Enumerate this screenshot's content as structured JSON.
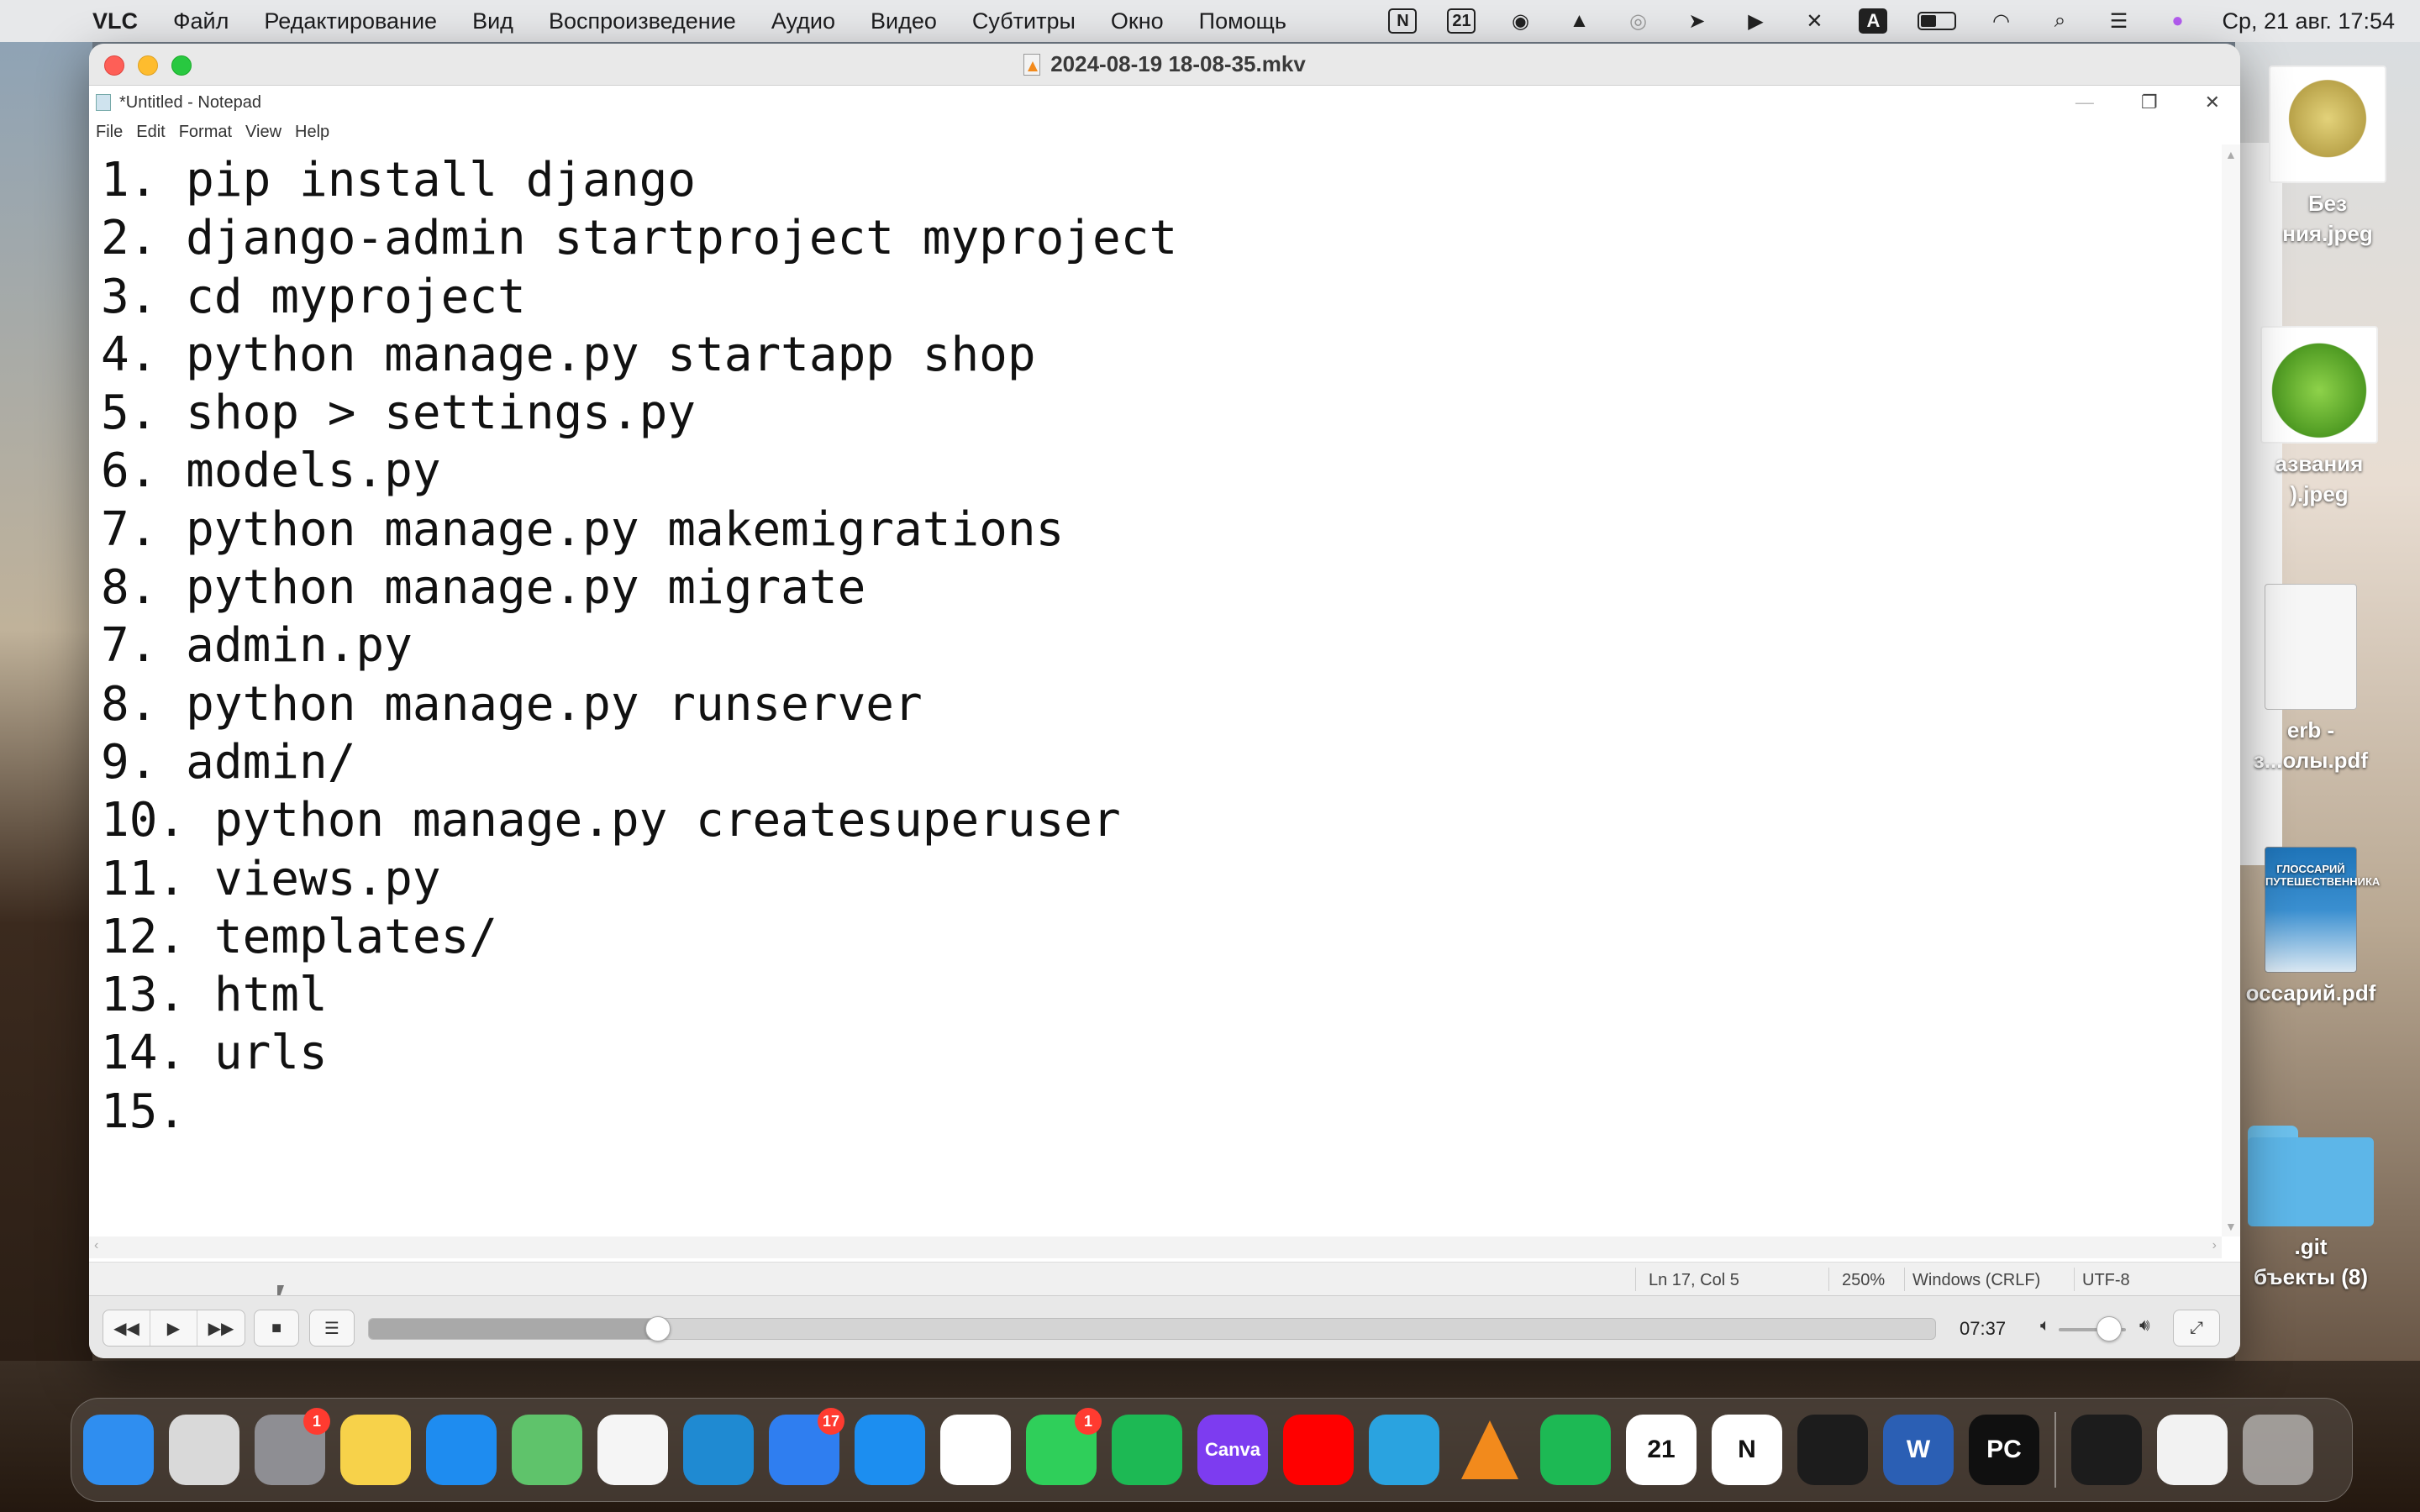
{
  "menubar": {
    "app_name": "VLC",
    "items": [
      "Файл",
      "Редактирование",
      "Вид",
      "Воспроизведение",
      "Аудио",
      "Видео",
      "Субтитры",
      "Окно",
      "Помощь"
    ],
    "status_icons": [
      "notion-icon",
      "calendar-icon",
      "face-icon",
      "vlc-icon",
      "airdrop-icon",
      "location-icon",
      "play-icon",
      "bluetooth-icon",
      "input-source-icon",
      "battery-icon",
      "wifi-icon",
      "spotlight-icon",
      "control-center-icon",
      "siri-icon"
    ],
    "status_texts": {
      "notion": "N",
      "calendar": "21",
      "input_source": "A"
    },
    "clock": "Ср, 21 авг.  17:54"
  },
  "vlc": {
    "title": "2024-08-19 18-08-35.mkv",
    "time": "07:37",
    "progress": 0.185,
    "volume": 0.75
  },
  "notepad": {
    "title": "*Untitled - Notepad",
    "menu": [
      "File",
      "Edit",
      "Format",
      "View",
      "Help"
    ],
    "lines": [
      "1. pip install django",
      "2. django-admin startproject myproject",
      "3. cd myproject",
      "4. python manage.py startapp shop",
      "5. shop > settings.py",
      "6. models.py",
      "7. python manage.py makemigrations",
      "8. python manage.py migrate",
      "7. admin.py",
      "8. python manage.py runserver",
      "9. admin/",
      "10. python manage.py createsuperuser",
      "11. views.py",
      "12. templates/",
      "13. html",
      "14. urls",
      "15. "
    ],
    "status": {
      "position": "Ln 17, Col 5",
      "zoom": "250%",
      "line_ending": "Windows (CRLF)",
      "encoding": "UTF-8"
    }
  },
  "desktop": {
    "items": [
      {
        "label_line1": "Без",
        "label_line2": "ния.jpeg",
        "type": "image"
      },
      {
        "label_line1": "азвания",
        "label_line2": ").jpeg",
        "type": "image"
      },
      {
        "label_line1": "erb -",
        "label_line2": "з...олы.pdf",
        "type": "pdf"
      },
      {
        "label_line1": "",
        "label_line2": "оссарий.pdf",
        "type": "pdf"
      },
      {
        "label_line1": ".git",
        "label_line2": "бъекты (8)",
        "type": "folder"
      }
    ],
    "book_title": "ГЛОССАРИЙ ПУТЕШЕСТВЕННИКА"
  },
  "dock": {
    "apps": [
      {
        "name": "finder-icon",
        "color": "#2f8ef0",
        "glyph": ""
      },
      {
        "name": "launchpad-icon",
        "color": "#d9d9d9",
        "glyph": ""
      },
      {
        "name": "system-settings-icon",
        "color": "#8e8e93",
        "glyph": "",
        "badge": "1"
      },
      {
        "name": "notes-icon",
        "color": "#f7d24a",
        "glyph": ""
      },
      {
        "name": "safari-icon",
        "color": "#1e8cf0",
        "glyph": ""
      },
      {
        "name": "maps-icon",
        "color": "#5fc36b",
        "glyph": ""
      },
      {
        "name": "photos-icon",
        "color": "#f5f5f5",
        "glyph": ""
      },
      {
        "name": "vscode-icon",
        "color": "#1f8ad2",
        "glyph": ""
      },
      {
        "name": "mail-icon",
        "color": "#2f7ef0",
        "glyph": "",
        "badge": "17"
      },
      {
        "name": "app-store-icon",
        "color": "#1c8ef0",
        "glyph": ""
      },
      {
        "name": "chrome-icon",
        "color": "#ffffff",
        "glyph": ""
      },
      {
        "name": "whatsapp-icon",
        "color": "#2fcf5a",
        "glyph": "",
        "badge": "1"
      },
      {
        "name": "spotify-icon",
        "color": "#1db954",
        "glyph": ""
      },
      {
        "name": "canva-icon",
        "color": "#7d3cf0",
        "glyph": "Canva"
      },
      {
        "name": "youtube-icon",
        "color": "#ff0000",
        "glyph": ""
      },
      {
        "name": "telegram-icon",
        "color": "#2aa3e0",
        "glyph": ""
      },
      {
        "name": "vlc-dock-icon",
        "color": "transparent",
        "glyph": ""
      },
      {
        "name": "spotify-alt-icon",
        "color": "#1db954",
        "glyph": ""
      },
      {
        "name": "calendar-dock-icon",
        "color": "#ffffff",
        "glyph": "21"
      },
      {
        "name": "notion-dock-icon",
        "color": "#ffffff",
        "glyph": "N"
      },
      {
        "name": "terminal-icon",
        "color": "#1c1c1c",
        "glyph": ""
      },
      {
        "name": "word-icon",
        "color": "#2b5fb4",
        "glyph": "W"
      },
      {
        "name": "pycharm-icon",
        "color": "#101010",
        "glyph": "PC"
      }
    ],
    "recent": [
      "recent-terminal-window-icon",
      "recent-chrome-window-icon",
      "trash-icon"
    ]
  }
}
